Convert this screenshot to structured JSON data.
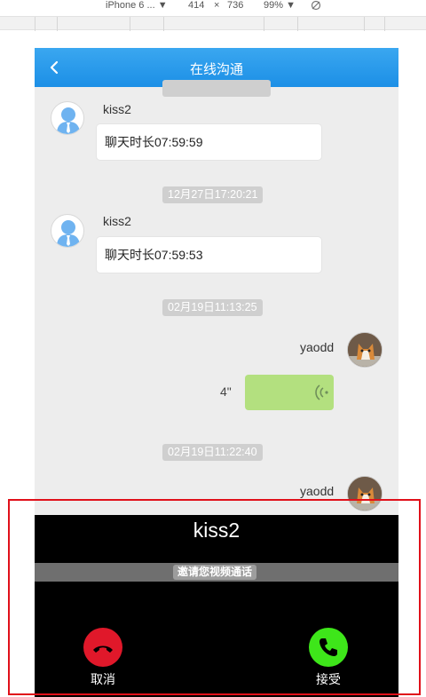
{
  "devtools": {
    "device": "iPhone 6 ...",
    "device_arrow": "▼",
    "width": "414",
    "times": "×",
    "height": "736",
    "zoom": "99%",
    "zoom_arrow": "▼"
  },
  "header": {
    "title": "在线沟通"
  },
  "messages": {
    "time_1": "12月27日17:20:21",
    "time_2": "02月19日11:13:25",
    "time_3": "02月19日11:22:40",
    "msg_1": {
      "sender": "kiss2",
      "text": "聊天时长07:59:59"
    },
    "msg_2": {
      "sender": "kiss2",
      "text": "聊天时长07:59:53"
    },
    "msg_3": {
      "sender": "yaodd",
      "duration": "4\""
    },
    "msg_4": {
      "sender": "yaodd"
    }
  },
  "call": {
    "caller": "kiss2",
    "invite_text": "邀请您视频通话",
    "cancel_label": "取消",
    "accept_label": "接受"
  },
  "colors": {
    "header": "#1c8fe6",
    "voice_bubble": "#b3e07f",
    "cancel": "#e0182a",
    "accept": "#3ee61a",
    "highlight": "#e0101a"
  }
}
